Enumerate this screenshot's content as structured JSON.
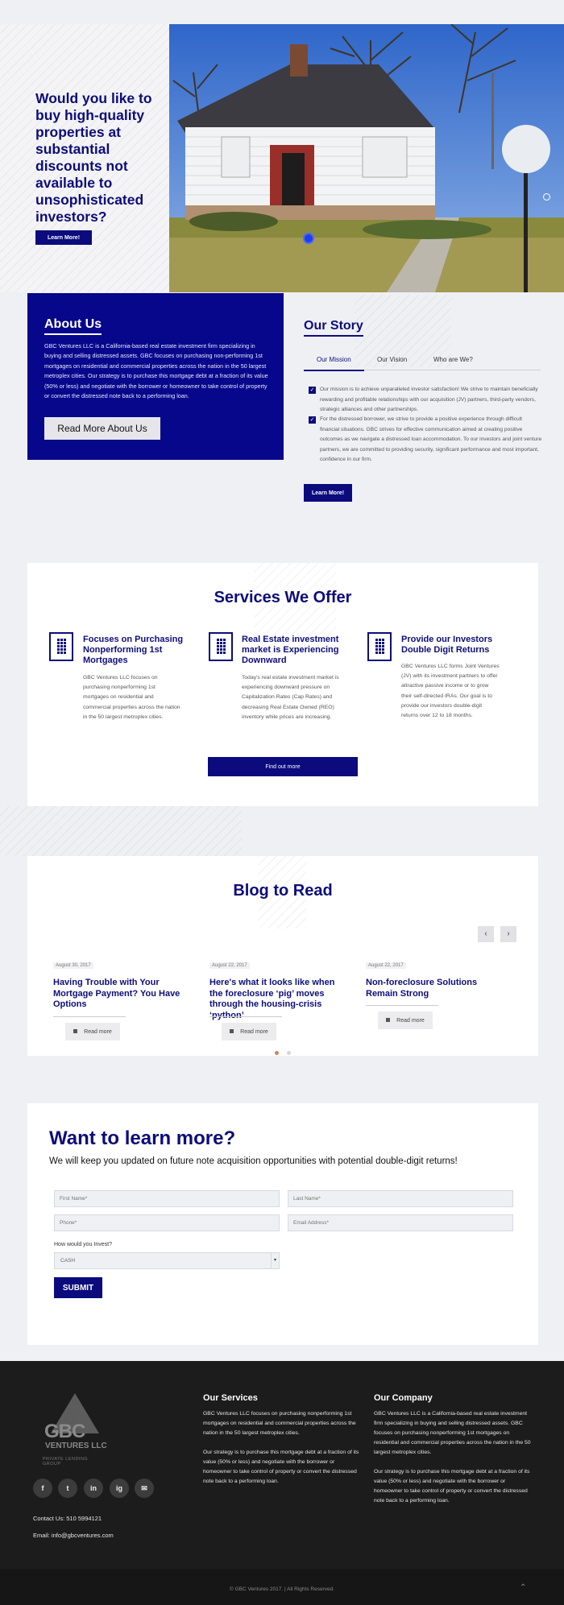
{
  "hero": {
    "title": "Would you like to buy high-quality properties at substantial discounts not available to unsophisticated investors?",
    "button_label": "Learn More!"
  },
  "about": {
    "title": "About Us",
    "text": "GBC Ventures LLC is a California-based real estate investment firm specializing in buying and selling distressed assets. GBC focuses on purchasing non-performing 1st mortgages on residential and commercial properties across the nation in the 50 largest metroplex cities. Our strategy is to purchase this mortgage debt at a fraction of its value (50% or less) and negotiate with the borrower or homeowner to take control of property or convert the distressed note back to a performing loan.",
    "button_label": "Read More About Us"
  },
  "story": {
    "title": "Our Story",
    "tabs": [
      "Our Mission",
      "Our Vision",
      "Who are We?"
    ],
    "items": [
      "Our mission is to achieve unparalleled investor satisfaction! We strive to maintain beneficially rewarding and profitable relationships with our acquisition (JV) partners, third-party vendors, strategic alliances and other partnerships.",
      "For the distressed borrower, we strive to provide a positive experience through difficult financial situations. GBC strives for effective communication aimed at creating positive outcomes as we navigate a distressed loan accommodation. To our investors and joint venture partners, we are committed to providing security, significant performance and most important, confidence in our firm."
    ],
    "button_label": "Learn More!"
  },
  "services": {
    "title": "Services We Offer",
    "items": [
      {
        "title": "Focuses on Purchasing Nonperforming 1st Mortgages",
        "text": "GBC Ventures LLC focuses on purchasing nonperforming 1st mortgages on residential and commercial properties across the nation in the 50 largest metroplex cities."
      },
      {
        "title": "Real Estate investment market is Experiencing Downward",
        "text": "Today's real estate investment market is experiencing downward pressure on Capitalization Rates (Cap Rates) and decreasing Real Estate Owned (REO) inventory while prices are increasing."
      },
      {
        "title": "Provide our Investors Double Digit Returns",
        "text": "GBC Ventures LLC forms Joint Ventures (JV) with its investment partners to offer attractive passive income or to grow their self-directed IRAs. Our goal is to provide our investors double-digit returns over 12 to 18 months."
      }
    ],
    "button_label": "Find out more"
  },
  "blog": {
    "title": "Blog to Read",
    "posts": [
      {
        "date": "August 30, 2017",
        "title": "Having Trouble with Your Mortgage Payment? You Have Options",
        "button": "Read more"
      },
      {
        "date": "August 22, 2017",
        "title": "Here's what it looks like when the foreclosure ‘pig’ moves through the housing-crisis ‘python’",
        "button": "Read more"
      },
      {
        "date": "August 22, 2017",
        "title": "Non-foreclosure Solutions Remain Strong",
        "button": "Read more"
      }
    ],
    "prev": "‹",
    "next": "›"
  },
  "form": {
    "title": "Want to learn more?",
    "subtitle": "We will keep you updated on future note acquisition opportunities with potential double-digit returns!",
    "first_name": "First Name*",
    "last_name": "Last Name*",
    "phone": "Phone*",
    "email": "Email Address*",
    "invest_label": "How would you Invest?",
    "invest_value": "CASH",
    "submit": "SUBMIT"
  },
  "footer": {
    "logo": {
      "gbc": "GBC",
      "ventures": "VENTURES LLC",
      "tagline": "PRIVATE LENDING GROUP"
    },
    "social": [
      "f",
      "t",
      "in",
      "ig",
      "✉"
    ],
    "contact_phone": "Contact Us: 510 5994121",
    "contact_email": "Email: info@gbcventures.com",
    "services_title": "Our Services",
    "services_text_1": "GBC Ventures LLC focuses on purchasing nonperforming 1st mortgages on residential and commercial properties across the nation in the 50 largest metroplex cities.",
    "services_text_2": "Our strategy is to purchase this mortgage debt at a fraction of its value (50% or less) and negotiate with the borrower or homeowner to take control of property or convert the distressed note back to a performing loan.",
    "company_title": "Our Company",
    "company_text_1": "GBC Ventures LLC is a California-based real estate investment firm specializing in buying and selling distressed assets. GBC focuses on purchasing nonperforming 1st mortgages on residential and commercial properties across the nation in the 50 largest metroplex cities.",
    "company_text_2": "Our strategy is to purchase this mortgage debt at a fraction of its value (50% or less) and negotiate with the borrower or homeowner to take control of property or convert the distressed note back to a performing loan.",
    "copyright": "© GBC Ventures 2017. | All Rights Reserved.",
    "to_top": "⌃"
  }
}
